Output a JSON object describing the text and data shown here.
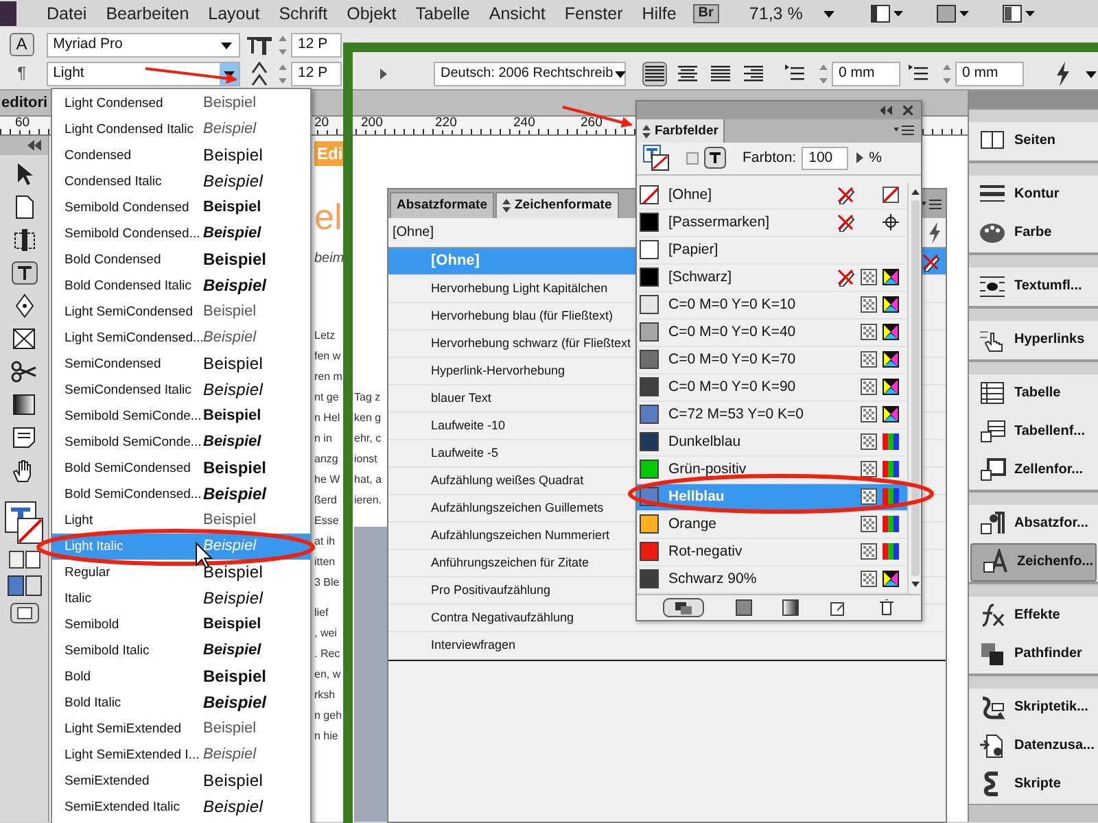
{
  "menu_bar": {
    "items": [
      "Datei",
      "Bearbeiten",
      "Layout",
      "Schrift",
      "Objekt",
      "Tabelle",
      "Ansicht",
      "Fenster",
      "Hilfe"
    ],
    "bridge_button": "Br",
    "zoom": "71,3 %"
  },
  "control_bar": {
    "mode_buttons": [
      "A",
      "¶"
    ],
    "font_family": "Myriad Pro",
    "font_style": "Light",
    "font_size": "12 P",
    "leading": "12 P",
    "language": "Deutsch: 2006 Rechtschreib",
    "indent_fields": [
      "0 mm",
      "0 mm"
    ]
  },
  "document_tab": {
    "title": "editori"
  },
  "ruler": {
    "labels": [
      "60",
      "20",
      "200",
      "220",
      "240",
      "260"
    ]
  },
  "page": {
    "heading": "Edi",
    "title_fragment": "el",
    "subtitle_fragment": "beim",
    "left_lines": [
      "Letz",
      "fen w",
      "ren m",
      "nt ge",
      "n Hel",
      "n in",
      "anzg",
      "he W",
      "ßerd",
      "Esse",
      "at ih",
      "itten",
      "3 Ble",
      "lief",
      ", wei",
      ". Rec",
      "en, w",
      "rksh",
      "n geh",
      "n hie"
    ],
    "right_lines": [
      "Tag z",
      "ken g",
      "ehr, c",
      "ionst",
      "hat, a",
      "ieren."
    ]
  },
  "font_style_menu": {
    "items": [
      {
        "name": "Light Condensed",
        "sample": "Beispiel",
        "kind": "light",
        "italic": false,
        "selected": false
      },
      {
        "name": "Light Condensed Italic",
        "sample": "Beispiel",
        "kind": "light",
        "italic": true,
        "selected": false
      },
      {
        "name": "Condensed",
        "sample": "Beispiel",
        "kind": "regular",
        "italic": false,
        "selected": false
      },
      {
        "name": "Condensed Italic",
        "sample": "Beispiel",
        "kind": "regular",
        "italic": true,
        "selected": false
      },
      {
        "name": "Semibold Condensed",
        "sample": "Beispiel",
        "kind": "semibold",
        "italic": false,
        "selected": false
      },
      {
        "name": "Semibold Condensed...",
        "sample": "Beispiel",
        "kind": "semibold",
        "italic": true,
        "selected": false
      },
      {
        "name": "Bold Condensed",
        "sample": "Beispiel",
        "kind": "bold",
        "italic": false,
        "selected": false
      },
      {
        "name": "Bold Condensed Italic",
        "sample": "Beispiel",
        "kind": "bold",
        "italic": true,
        "selected": false
      },
      {
        "name": "Light SemiCondensed",
        "sample": "Beispiel",
        "kind": "light",
        "italic": false,
        "selected": false
      },
      {
        "name": "Light SemiCondensed...",
        "sample": "Beispiel",
        "kind": "light",
        "italic": true,
        "selected": false
      },
      {
        "name": "SemiCondensed",
        "sample": "Beispiel",
        "kind": "regular",
        "italic": false,
        "selected": false
      },
      {
        "name": "SemiCondensed Italic",
        "sample": "Beispiel",
        "kind": "regular",
        "italic": true,
        "selected": false
      },
      {
        "name": "Semibold SemiConde...",
        "sample": "Beispiel",
        "kind": "semibold",
        "italic": false,
        "selected": false
      },
      {
        "name": "Semibold SemiConde...",
        "sample": "Beispiel",
        "kind": "semibold",
        "italic": true,
        "selected": false
      },
      {
        "name": "Bold SemiCondensed",
        "sample": "Beispiel",
        "kind": "bold",
        "italic": false,
        "selected": false
      },
      {
        "name": "Bold SemiCondensed...",
        "sample": "Beispiel",
        "kind": "bold",
        "italic": true,
        "selected": false
      },
      {
        "name": "Light",
        "sample": "Beispiel",
        "kind": "light",
        "italic": false,
        "selected": false
      },
      {
        "name": "Light Italic",
        "sample": "Beispiel",
        "kind": "light",
        "italic": true,
        "selected": true
      },
      {
        "name": "Regular",
        "sample": "Beispiel",
        "kind": "regular",
        "italic": false,
        "selected": false
      },
      {
        "name": "Italic",
        "sample": "Beispiel",
        "kind": "regular",
        "italic": true,
        "selected": false
      },
      {
        "name": "Semibold",
        "sample": "Beispiel",
        "kind": "semibold",
        "italic": false,
        "selected": false
      },
      {
        "name": "Semibold Italic",
        "sample": "Beispiel",
        "kind": "semibold",
        "italic": true,
        "selected": false
      },
      {
        "name": "Bold",
        "sample": "Beispiel",
        "kind": "bold",
        "italic": false,
        "selected": false
      },
      {
        "name": "Bold Italic",
        "sample": "Beispiel",
        "kind": "bold",
        "italic": true,
        "selected": false
      },
      {
        "name": "Light SemiExtended",
        "sample": "Beispiel",
        "kind": "light",
        "italic": false,
        "selected": false
      },
      {
        "name": "Light SemiExtended I...",
        "sample": "Beispiel",
        "kind": "light",
        "italic": true,
        "selected": false
      },
      {
        "name": "SemiExtended",
        "sample": "Beispiel",
        "kind": "regular",
        "italic": false,
        "selected": false
      },
      {
        "name": "SemiExtended Italic",
        "sample": "Beispiel",
        "kind": "regular",
        "italic": true,
        "selected": false
      }
    ]
  },
  "formats_panel": {
    "tabs": [
      {
        "label": "Absatzformate",
        "selected": false
      },
      {
        "label": "Zeichenformate",
        "selected": true
      }
    ],
    "current_style": "[Ohne]",
    "styles": [
      {
        "name": "[Ohne]",
        "selected": true
      },
      {
        "name": "Hervorhebung Light Kapitälchen",
        "selected": false
      },
      {
        "name": "Hervorhebung blau (für Fließtext)",
        "selected": false
      },
      {
        "name": "Hervorhebung schwarz (für Fließtext",
        "selected": false
      },
      {
        "name": "Hyperlink-Hervorhebung",
        "selected": false
      },
      {
        "name": "blauer Text",
        "selected": false
      },
      {
        "name": "Laufweite -10",
        "selected": false
      },
      {
        "name": "Laufweite -5",
        "selected": false
      },
      {
        "name": "Aufzählung weißes Quadrat",
        "selected": false
      },
      {
        "name": "Aufzählungszeichen Guillemets",
        "selected": false
      },
      {
        "name": "Aufzählungszeichen Nummeriert",
        "selected": false
      },
      {
        "name": "Anführungszeichen für Zitate",
        "selected": false
      },
      {
        "name": "Pro Positivaufzählung",
        "selected": false
      },
      {
        "name": "Contra Negativaufzählung",
        "selected": false
      },
      {
        "name": "Interviewfragen",
        "selected": false
      }
    ]
  },
  "swatches_panel": {
    "title": "Farbfelder",
    "tint_label": "Farbton:",
    "tint_value": "100",
    "tint_unit": "%",
    "swatches": [
      {
        "name": "[Ohne]",
        "color": "#ffffff",
        "kind": "none",
        "locked": true,
        "selected": false
      },
      {
        "name": "[Passermarken]",
        "color": "#000000",
        "kind": "registration",
        "locked": true,
        "selected": false
      },
      {
        "name": "[Papier]",
        "color": "#ffffff",
        "kind": "paper",
        "locked": false,
        "selected": false
      },
      {
        "name": "[Schwarz]",
        "color": "#000000",
        "kind": "cmyk",
        "locked": true,
        "selected": false
      },
      {
        "name": "C=0 M=0 Y=0 K=10",
        "color": "#e6e6e6",
        "kind": "cmyk",
        "locked": false,
        "selected": false
      },
      {
        "name": "C=0 M=0 Y=0 K=40",
        "color": "#a6a6a6",
        "kind": "cmyk",
        "locked": false,
        "selected": false
      },
      {
        "name": "C=0 M=0 Y=0 K=70",
        "color": "#6d6d6d",
        "kind": "cmyk",
        "locked": false,
        "selected": false
      },
      {
        "name": "C=0 M=0 Y=0 K=90",
        "color": "#404040",
        "kind": "cmyk",
        "locked": false,
        "selected": false
      },
      {
        "name": "C=72 M=53 Y=0 K=0",
        "color": "#5a7bc0",
        "kind": "cmyk",
        "locked": false,
        "selected": false
      },
      {
        "name": "Dunkelblau",
        "color": "#1d3a5c",
        "kind": "rgb",
        "locked": false,
        "selected": false
      },
      {
        "name": "Grün-positiv",
        "color": "#00c800",
        "kind": "rgb",
        "locked": false,
        "selected": false
      },
      {
        "name": "Hellblau",
        "color": "#5b7fc4",
        "kind": "rgb",
        "locked": false,
        "selected": true
      },
      {
        "name": "Orange",
        "color": "#ffb020",
        "kind": "rgb",
        "locked": false,
        "selected": false
      },
      {
        "name": "Rot-negativ",
        "color": "#ee1c0e",
        "kind": "rgb",
        "locked": false,
        "selected": false
      },
      {
        "name": "Schwarz 90%",
        "color": "#3c3c3c",
        "kind": "cmyk",
        "locked": false,
        "selected": false
      }
    ]
  },
  "panel_dock": {
    "groups": [
      {
        "items": [
          {
            "label": "Seiten",
            "selected": false
          }
        ]
      },
      {
        "items": [
          {
            "label": "Kontur",
            "selected": false
          },
          {
            "label": "Farbe",
            "selected": false
          }
        ]
      },
      {
        "items": [
          {
            "label": "Textumfl...",
            "selected": false
          }
        ]
      },
      {
        "items": [
          {
            "label": "Hyperlinks",
            "selected": false
          }
        ]
      },
      {
        "items": [
          {
            "label": "Tabelle",
            "selected": false
          },
          {
            "label": "Tabellenf...",
            "selected": false
          },
          {
            "label": "Zellenfor...",
            "selected": false
          }
        ]
      },
      {
        "items": [
          {
            "label": "Absatzfor...",
            "selected": false
          },
          {
            "label": "Zeichenfo...",
            "selected": true
          }
        ]
      },
      {
        "items": [
          {
            "label": "Effekte",
            "selected": false
          },
          {
            "label": "Pathfinder",
            "selected": false
          }
        ]
      },
      {
        "items": [
          {
            "label": "Skriptetik...",
            "selected": false
          },
          {
            "label": "Datenzusa...",
            "selected": false
          },
          {
            "label": "Skripte",
            "selected": false
          }
        ]
      }
    ]
  }
}
